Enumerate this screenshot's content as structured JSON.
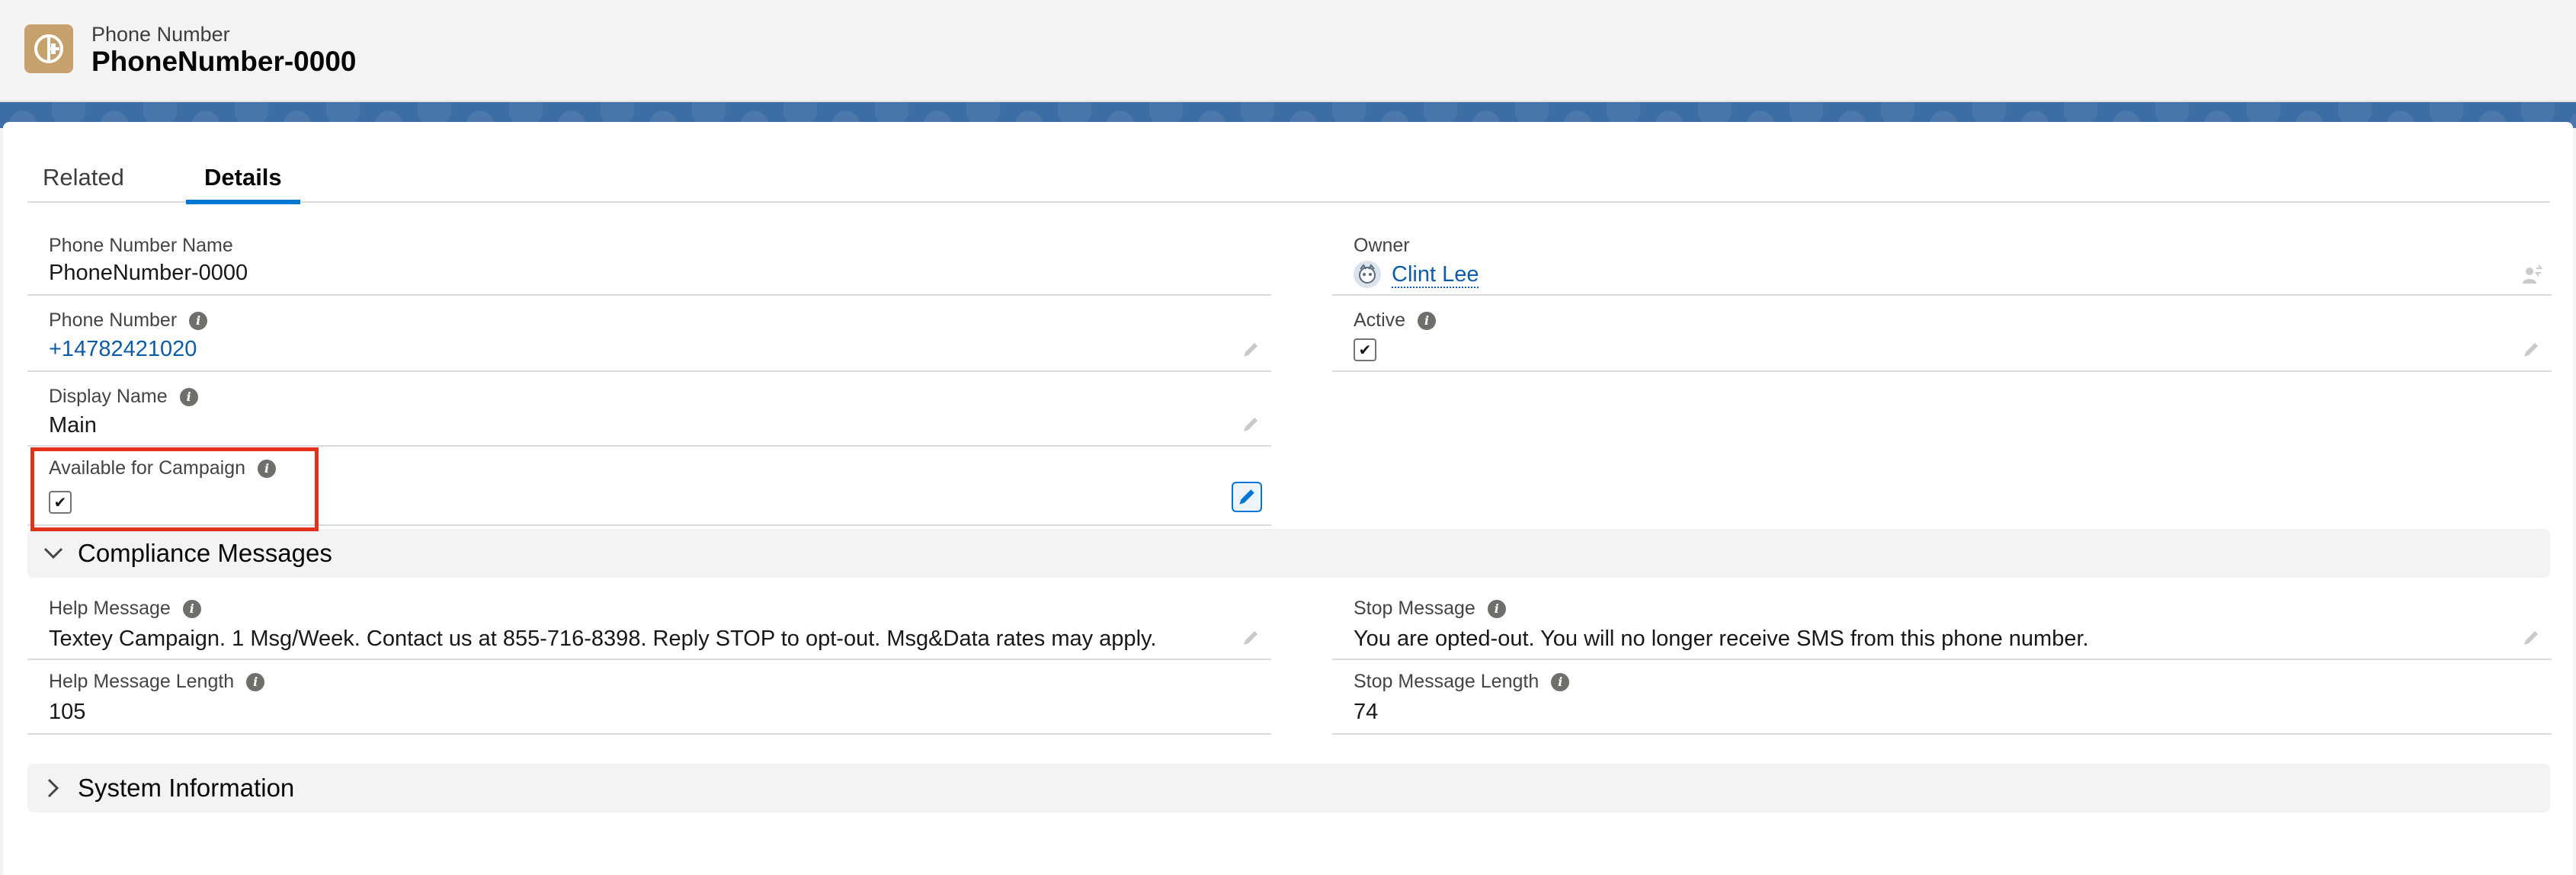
{
  "header": {
    "object_label": "Phone Number",
    "record_title": "PhoneNumber-0000",
    "icon": "phone-number-object-icon",
    "icon_color": "#c6a16d"
  },
  "banner_color": "#3d6da5",
  "tabs": [
    {
      "label": "Related",
      "active": false
    },
    {
      "label": "Details",
      "active": true
    }
  ],
  "fields": {
    "phone_number_name": {
      "label": "Phone Number Name",
      "value": "PhoneNumber-0000"
    },
    "owner": {
      "label": "Owner",
      "value": "Clint Lee"
    },
    "phone_number": {
      "label": "Phone Number",
      "value": "+14782421020"
    },
    "active": {
      "label": "Active",
      "checked": true
    },
    "display_name": {
      "label": "Display Name",
      "value": "Main"
    },
    "available_for_campaign": {
      "label": "Available for Campaign",
      "checked": true
    }
  },
  "sections": {
    "compliance": {
      "title": "Compliance Messages",
      "expanded": true,
      "help_message": {
        "label": "Help Message",
        "value": "Textey Campaign. 1 Msg/Week. Contact us at 855-716-8398. Reply STOP to opt-out. Msg&Data rates may apply."
      },
      "stop_message": {
        "label": "Stop Message",
        "value": "You are opted-out. You will no longer receive SMS from this phone number."
      },
      "help_message_length": {
        "label": "Help Message Length",
        "value": "105"
      },
      "stop_message_length": {
        "label": "Stop Message Length",
        "value": "74"
      }
    },
    "system_information": {
      "title": "System Information",
      "expanded": false
    }
  },
  "colors": {
    "accent": "#0176d3",
    "link": "#0b5cab",
    "highlight": "#e3321c"
  },
  "checkmark": "✔",
  "info_glyph": "i"
}
